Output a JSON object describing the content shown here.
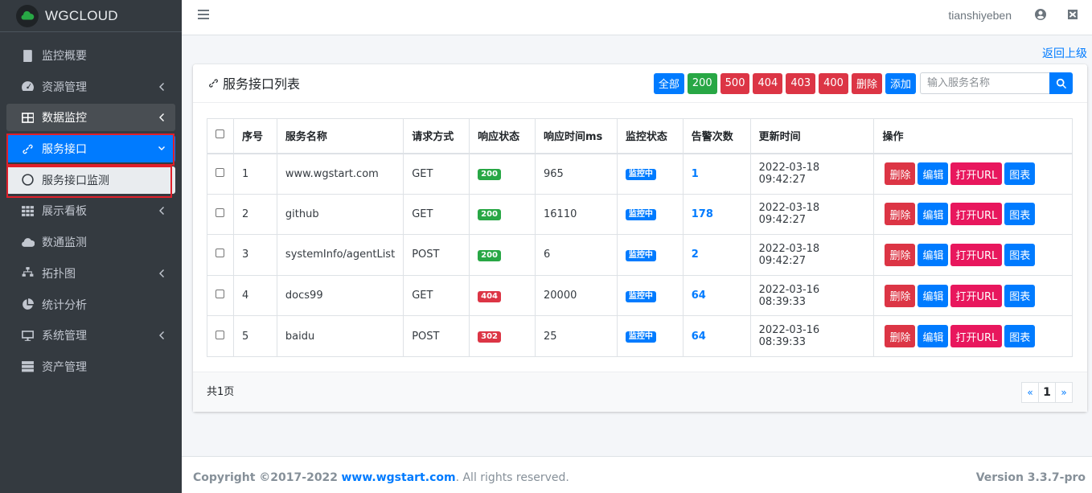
{
  "brand": {
    "name": "WGCLOUD"
  },
  "sidebar": {
    "items": [
      {
        "label": "监控概要",
        "icon": "book-icon"
      },
      {
        "label": "资源管理",
        "icon": "dashboard-icon"
      },
      {
        "label": "数据监控",
        "icon": "table-icon"
      },
      {
        "label": "服务接口",
        "icon": "link-icon"
      },
      {
        "label": "服务接口监测",
        "icon": "circle-icon"
      },
      {
        "label": "展示看板",
        "icon": "grid-icon"
      },
      {
        "label": "数通监测",
        "icon": "cloud-icon"
      },
      {
        "label": "拓扑图",
        "icon": "sitemap-icon"
      },
      {
        "label": "统计分析",
        "icon": "pie-chart-icon"
      },
      {
        "label": "系统管理",
        "icon": "desktop-icon"
      },
      {
        "label": "资产管理",
        "icon": "server-icon"
      }
    ]
  },
  "header": {
    "username": "tianshiyeben"
  },
  "back_link": "返回上级",
  "card": {
    "title": "服务接口列表",
    "filters": [
      {
        "label": "全部",
        "color": "#007bff"
      },
      {
        "label": "200",
        "color": "#28a745"
      },
      {
        "label": "500",
        "color": "#dc3545"
      },
      {
        "label": "404",
        "color": "#dc3545"
      },
      {
        "label": "403",
        "color": "#dc3545"
      },
      {
        "label": "400",
        "color": "#dc3545"
      }
    ],
    "delete_label": "删除",
    "add_label": "添加",
    "search_placeholder": "输入服务名称"
  },
  "table": {
    "headers": [
      "序号",
      "服务名称",
      "请求方式",
      "响应状态",
      "响应时间ms",
      "监控状态",
      "告警次数",
      "更新时间",
      "操作"
    ],
    "rows": [
      {
        "no": "1",
        "name": "www.wgstart.com",
        "method": "GET",
        "status": "200",
        "time": "965",
        "monitor": "监控中",
        "alarms": "1",
        "updated": "2022-03-18 09:42:27"
      },
      {
        "no": "2",
        "name": "github",
        "method": "GET",
        "status": "200",
        "time": "16110",
        "monitor": "监控中",
        "alarms": "178",
        "updated": "2022-03-18 09:42:27"
      },
      {
        "no": "3",
        "name": "systemInfo/agentList",
        "method": "POST",
        "status": "200",
        "time": "6",
        "monitor": "监控中",
        "alarms": "2",
        "updated": "2022-03-18 09:42:27"
      },
      {
        "no": "4",
        "name": "docs99",
        "method": "GET",
        "status": "404",
        "time": "20000",
        "monitor": "监控中",
        "alarms": "64",
        "updated": "2022-03-16 08:39:33"
      },
      {
        "no": "5",
        "name": "baidu",
        "method": "POST",
        "status": "302",
        "time": "25",
        "monitor": "监控中",
        "alarms": "64",
        "updated": "2022-03-16 08:39:33"
      }
    ],
    "ops": {
      "delete": "删除",
      "edit": "编辑",
      "open_url": "打开URL",
      "chart": "图表"
    }
  },
  "pagination": {
    "total_text": "共1页",
    "prev": "«",
    "current": "1",
    "next": "»"
  },
  "footer": {
    "copyright_prefix": "Copyright ©2017-2022",
    "site": "www.wgstart.com",
    "rights": ". All rights reserved.",
    "version_label": "Version",
    "version": "3.3.7-pro"
  },
  "colors": {
    "sidebar_bg": "#343a40",
    "primary": "#007bff",
    "success": "#28a745",
    "danger": "#dc3545",
    "pink": "#e8175d",
    "highlight_box": "#e0202b"
  }
}
